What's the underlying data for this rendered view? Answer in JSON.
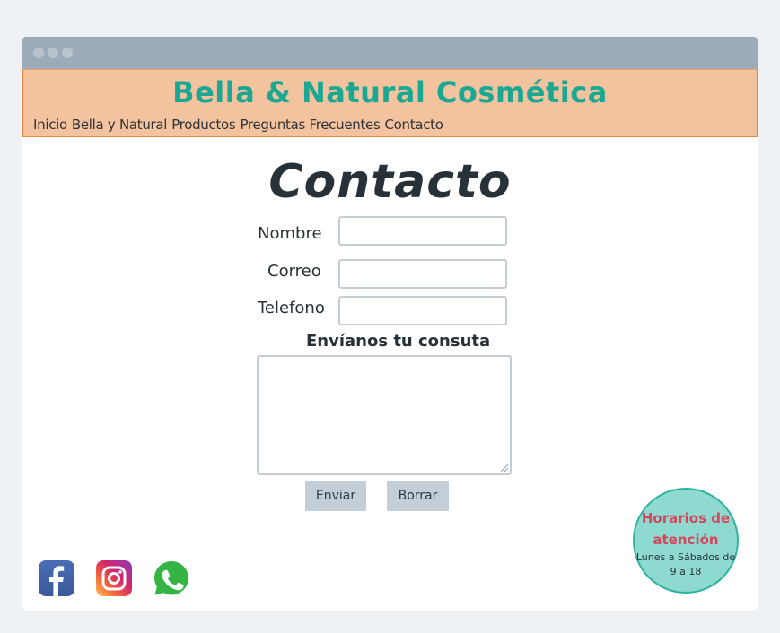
{
  "header": {
    "site_title": "Bella & Natural Cosmética",
    "nav": [
      {
        "label": "Inicio"
      },
      {
        "label": "Bella y Natural"
      },
      {
        "label": "Productos"
      },
      {
        "label": "Preguntas Frecuentes"
      },
      {
        "label": "Contacto"
      }
    ]
  },
  "main": {
    "title": "Contacto",
    "form": {
      "nombre_label": "Nombre",
      "correo_label": "Correo",
      "telefono_label": "Telefono",
      "consulta_label": "Envíanos tu consuta",
      "enviar_button": "Enviar",
      "borrar_button": "Borrar"
    }
  },
  "social": [
    {
      "icon": "facebook-icon",
      "color": "#3b5998"
    },
    {
      "icon": "instagram-icon",
      "color": "#c13584"
    },
    {
      "icon": "whatsapp-icon",
      "color": "#25d366"
    }
  ],
  "hours_badge": {
    "title": "Horarios de atención",
    "text": "Lunes a Sábados de 9 a 18"
  },
  "colors": {
    "page_bg": "#eff2f5",
    "header_bg": "#f3c29e",
    "title_color": "#1ba892",
    "badge_bg": "#8ed9d0",
    "badge_title": "#d6465c"
  }
}
